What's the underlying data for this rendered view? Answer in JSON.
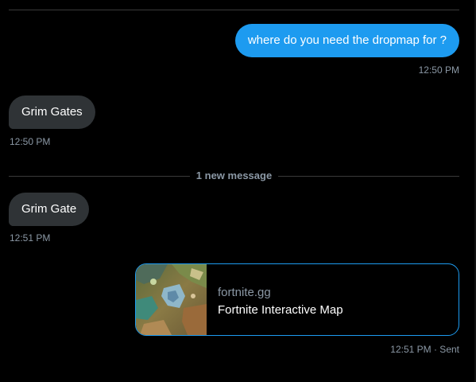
{
  "messages": {
    "outgoing_1": {
      "text": "where do you need the dropmap for ?",
      "time": "12:50 PM"
    },
    "incoming_1": {
      "text": "Grim Gates",
      "time": "12:50 PM"
    },
    "new_divider_label": "1 new message",
    "incoming_2": {
      "text": "Grim Gate",
      "time": "12:51 PM"
    },
    "link_card": {
      "domain": "fortnite.gg",
      "title": "Fortnite Interactive Map",
      "time": "12:51 PM · Sent",
      "thumbnail_icon": "map-thumbnail"
    }
  },
  "colors": {
    "background": "#000000",
    "outgoing_bubble": "#1d9bf0",
    "incoming_bubble": "#2f3336",
    "meta_text": "#8b98a5",
    "divider": "#3a3a3a"
  }
}
